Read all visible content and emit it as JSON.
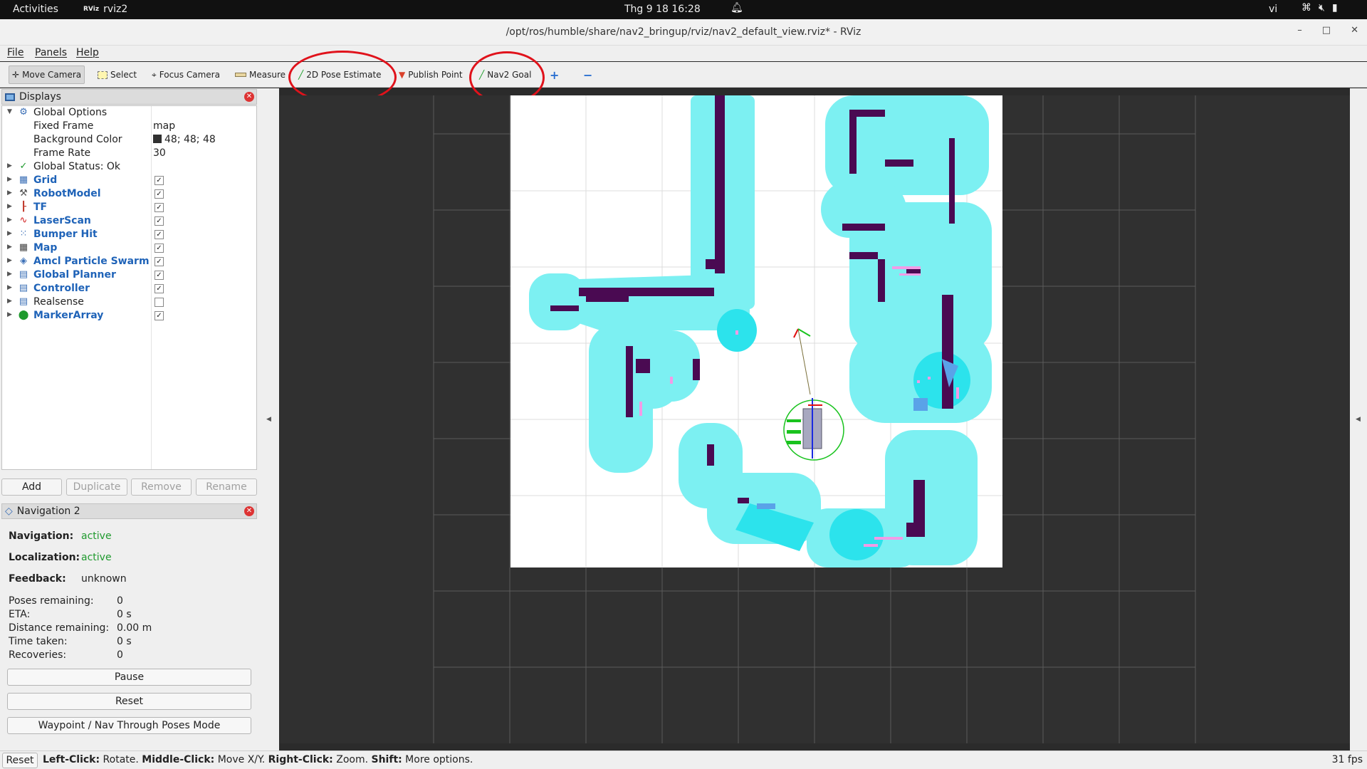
{
  "system_bar": {
    "activities": "Activities",
    "app_name": "rviz2",
    "app_logo": "RViz",
    "clock": "Thg 9 18  16:28",
    "language": "vi"
  },
  "window": {
    "title": "/opt/ros/humble/share/nav2_bringup/rviz/nav2_default_view.rviz* - RViz"
  },
  "menu": [
    "File",
    "Panels",
    "Help"
  ],
  "toolbar": {
    "move_camera": "Move Camera",
    "select": "Select",
    "focus_camera": "Focus Camera",
    "measure": "Measure",
    "pose_estimate": "2D Pose Estimate",
    "publish_point": "Publish Point",
    "nav2_goal": "Nav2 Goal",
    "add_tool": "+",
    "remove_tool": "−"
  },
  "displays_panel": {
    "title": "Displays",
    "global_options": "Global Options",
    "fixed_frame_label": "Fixed Frame",
    "fixed_frame_value": "map",
    "bg_color_label": "Background Color",
    "bg_color_value": "48; 48; 48",
    "bg_color_hex": "#303030",
    "frame_rate_label": "Frame Rate",
    "frame_rate_value": "30",
    "global_status": "Global Status: Ok",
    "items": [
      {
        "label": "Grid",
        "icon": "grid-icon",
        "checked": true
      },
      {
        "label": "RobotModel",
        "icon": "robot-icon",
        "checked": true
      },
      {
        "label": "TF",
        "icon": "axes-icon",
        "checked": true
      },
      {
        "label": "LaserScan",
        "icon": "laser-icon",
        "checked": true
      },
      {
        "label": "Bumper Hit",
        "icon": "bumper-icon",
        "checked": true
      },
      {
        "label": "Map",
        "icon": "map-icon",
        "checked": true
      },
      {
        "label": "Amcl Particle Swarm",
        "icon": "particle-icon",
        "checked": true
      },
      {
        "label": "Global Planner",
        "icon": "folder-icon",
        "checked": true
      },
      {
        "label": "Controller",
        "icon": "folder-icon",
        "checked": true
      },
      {
        "label": "Realsense",
        "icon": "folder-icon",
        "checked": false
      },
      {
        "label": "MarkerArray",
        "icon": "marker-icon",
        "checked": true
      }
    ],
    "buttons": {
      "add": "Add",
      "duplicate": "Duplicate",
      "remove": "Remove",
      "rename": "Rename"
    }
  },
  "nav_panel": {
    "title": "Navigation 2",
    "navigation_label": "Navigation:",
    "navigation_value": "active",
    "localization_label": "Localization:",
    "localization_value": "active",
    "feedback_label": "Feedback:",
    "feedback_value": "unknown",
    "poses_label": "Poses remaining:",
    "poses_value": "0",
    "eta_label": "ETA:",
    "eta_value": "0 s",
    "distance_label": "Distance remaining:",
    "distance_value": "0.00 m",
    "time_label": "Time taken:",
    "time_value": "0 s",
    "recoveries_label": "Recoveries:",
    "recoveries_value": "0",
    "pause": "Pause",
    "reset": "Reset",
    "waypoint_mode": "Waypoint / Nav Through Poses Mode"
  },
  "status_bar": {
    "reset": "Reset",
    "lc": "Left-Click:",
    "lc_txt": " Rotate. ",
    "mc": "Middle-Click:",
    "mc_txt": " Move X/Y. ",
    "rc": "Right-Click:",
    "rc_txt": " Zoom. ",
    "sh": "Shift:",
    "sh_txt": " More options.",
    "fps": "31 fps"
  },
  "colors": {
    "costmap": "#7cf0f2",
    "obstacle": "#4a0a52",
    "highlight_circle": "#e0121b",
    "status_active": "#1f9a2e",
    "link_blue": "#1f63b8"
  }
}
